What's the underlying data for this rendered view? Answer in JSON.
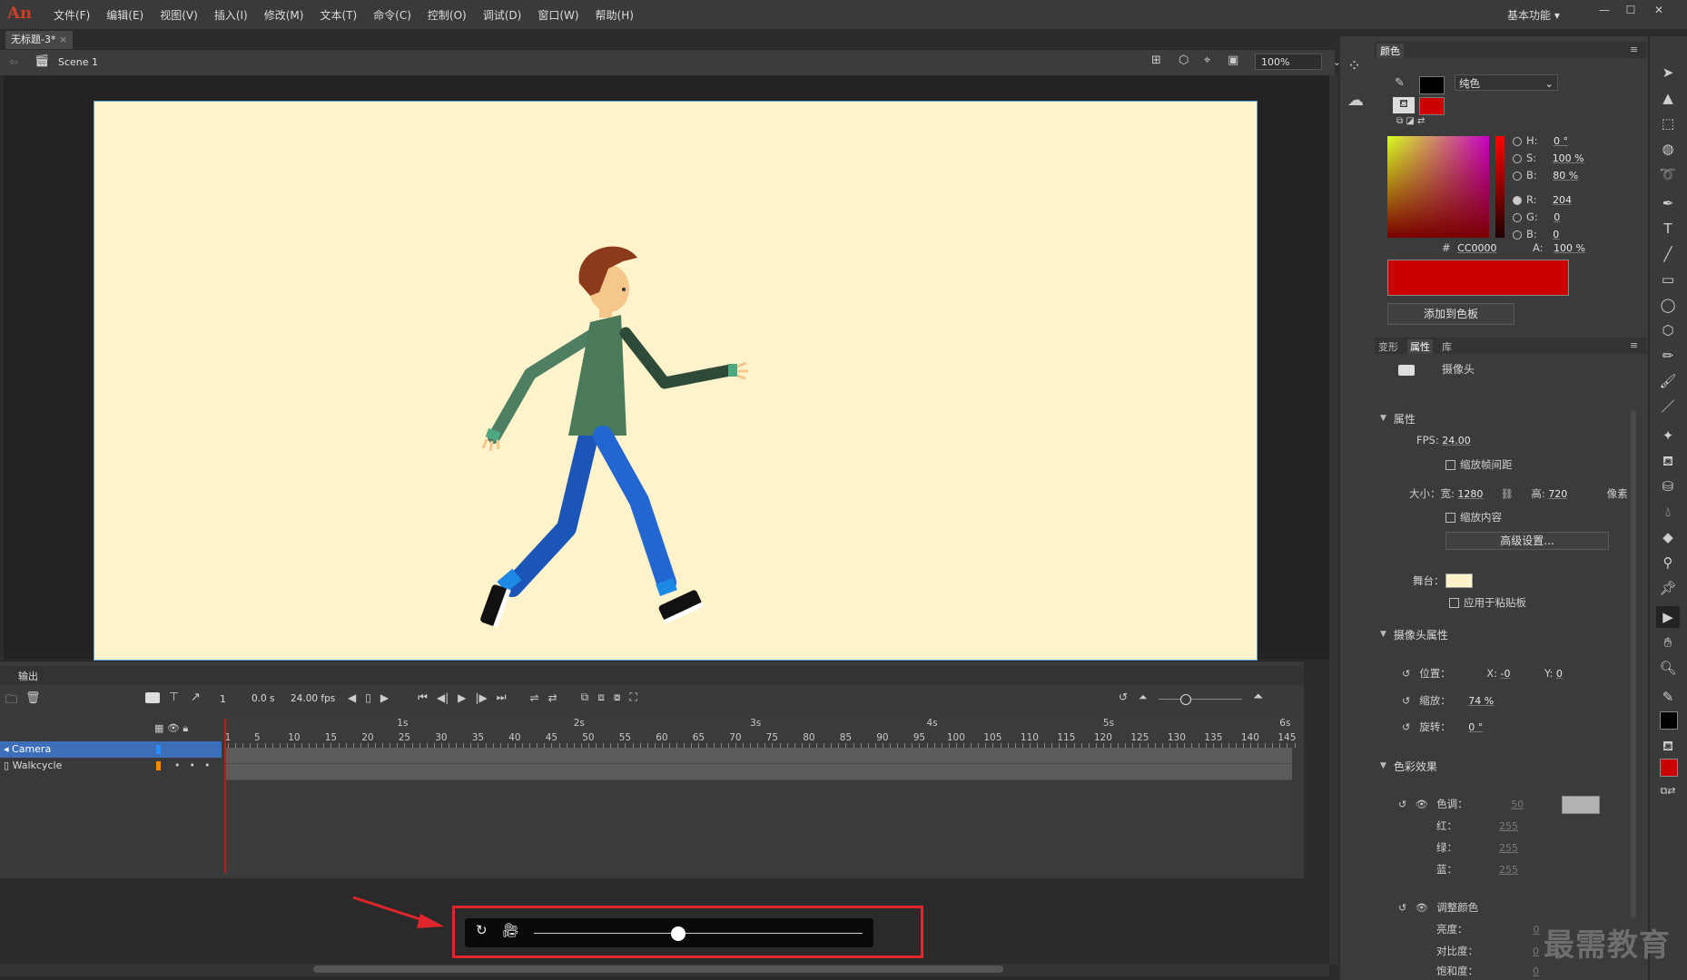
{
  "app": {
    "logo": "An"
  },
  "menu": [
    "文件(F)",
    "编辑(E)",
    "视图(V)",
    "插入(I)",
    "修改(M)",
    "文本(T)",
    "命令(C)",
    "控制(O)",
    "调试(D)",
    "窗口(W)",
    "帮助(H)"
  ],
  "workspace": "基本功能",
  "document": {
    "tab": "无标题-3*",
    "scene": "Scene 1",
    "zoom": "100%"
  },
  "timeline": {
    "tab": "输出",
    "frame": "1",
    "time": "0.0 s",
    "fps": "24.00 fps",
    "seconds": [
      "1s",
      "2s",
      "3s",
      "4s",
      "5s",
      "6s"
    ],
    "ticks": [
      "1",
      "5",
      "10",
      "15",
      "20",
      "25",
      "30",
      "35",
      "40",
      "45",
      "50",
      "55",
      "60",
      "65",
      "70",
      "75",
      "80",
      "85",
      "90",
      "95",
      "100",
      "105",
      "110",
      "115",
      "120",
      "125",
      "130",
      "135",
      "140",
      "145"
    ],
    "layers": [
      {
        "name": "Camera",
        "color": "#2a8cff",
        "selected": true
      },
      {
        "name": "Walkcycle",
        "color": "#ff8a00",
        "selected": false
      }
    ]
  },
  "color_panel": {
    "title": "颜色",
    "fill_type": "纯色",
    "H": "0 °",
    "S": "100 %",
    "Bv": "80 %",
    "R": "204",
    "G": "0",
    "B": "0",
    "hex_label": "#",
    "hex": "CC0000",
    "alpha_label": "A:",
    "alpha": "100 %",
    "labels": {
      "H": "H:",
      "S": "S:",
      "Bv": "B:",
      "R": "R:",
      "G": "G:",
      "B": "B:"
    },
    "add_swatch": "添加到色板",
    "stroke_color": "#000000",
    "fill_color": "#cc0000"
  },
  "props_panel": {
    "tabs": [
      "变形",
      "属性",
      "库"
    ],
    "object": "摄像头",
    "section_props": "属性",
    "fps_label": "FPS:",
    "fps": "24.00",
    "scale_spacing": "缩放帧间距",
    "size_label": "大小：",
    "width_label": "宽:",
    "width": "1280",
    "height_label": "高:",
    "height": "720",
    "unit": "像素",
    "scale_content": "缩放内容",
    "advanced": "高级设置...",
    "stage_label": "舞台：",
    "stage_color": "#fff3cc",
    "apply_paste": "应用于粘贴板",
    "section_camera": "摄像头属性",
    "pos_label": "位置：",
    "x_label": "X:",
    "x": "-0",
    "y_label": "Y:",
    "y": "0",
    "zoom_label": "缩放：",
    "zoom": "74 %",
    "rotate_label": "旋转：",
    "rotate": "0 °",
    "section_color": "色彩效果",
    "tint_label": "色调：",
    "tint": "50",
    "tint_color": "#b3b3b3",
    "red_label": "红：",
    "red": "255",
    "green_label": "绿：",
    "green": "255",
    "blue_label": "蓝：",
    "blue": "255",
    "adjust_label": "调整颜色",
    "brightness_label": "亮度：",
    "brightness": "0",
    "contrast_label": "对比度：",
    "contrast": "0",
    "saturation_label": "饱和度：",
    "saturation": "0"
  },
  "camera_zoom_slider": {
    "level": 0.44
  },
  "watermark": "最需教育"
}
